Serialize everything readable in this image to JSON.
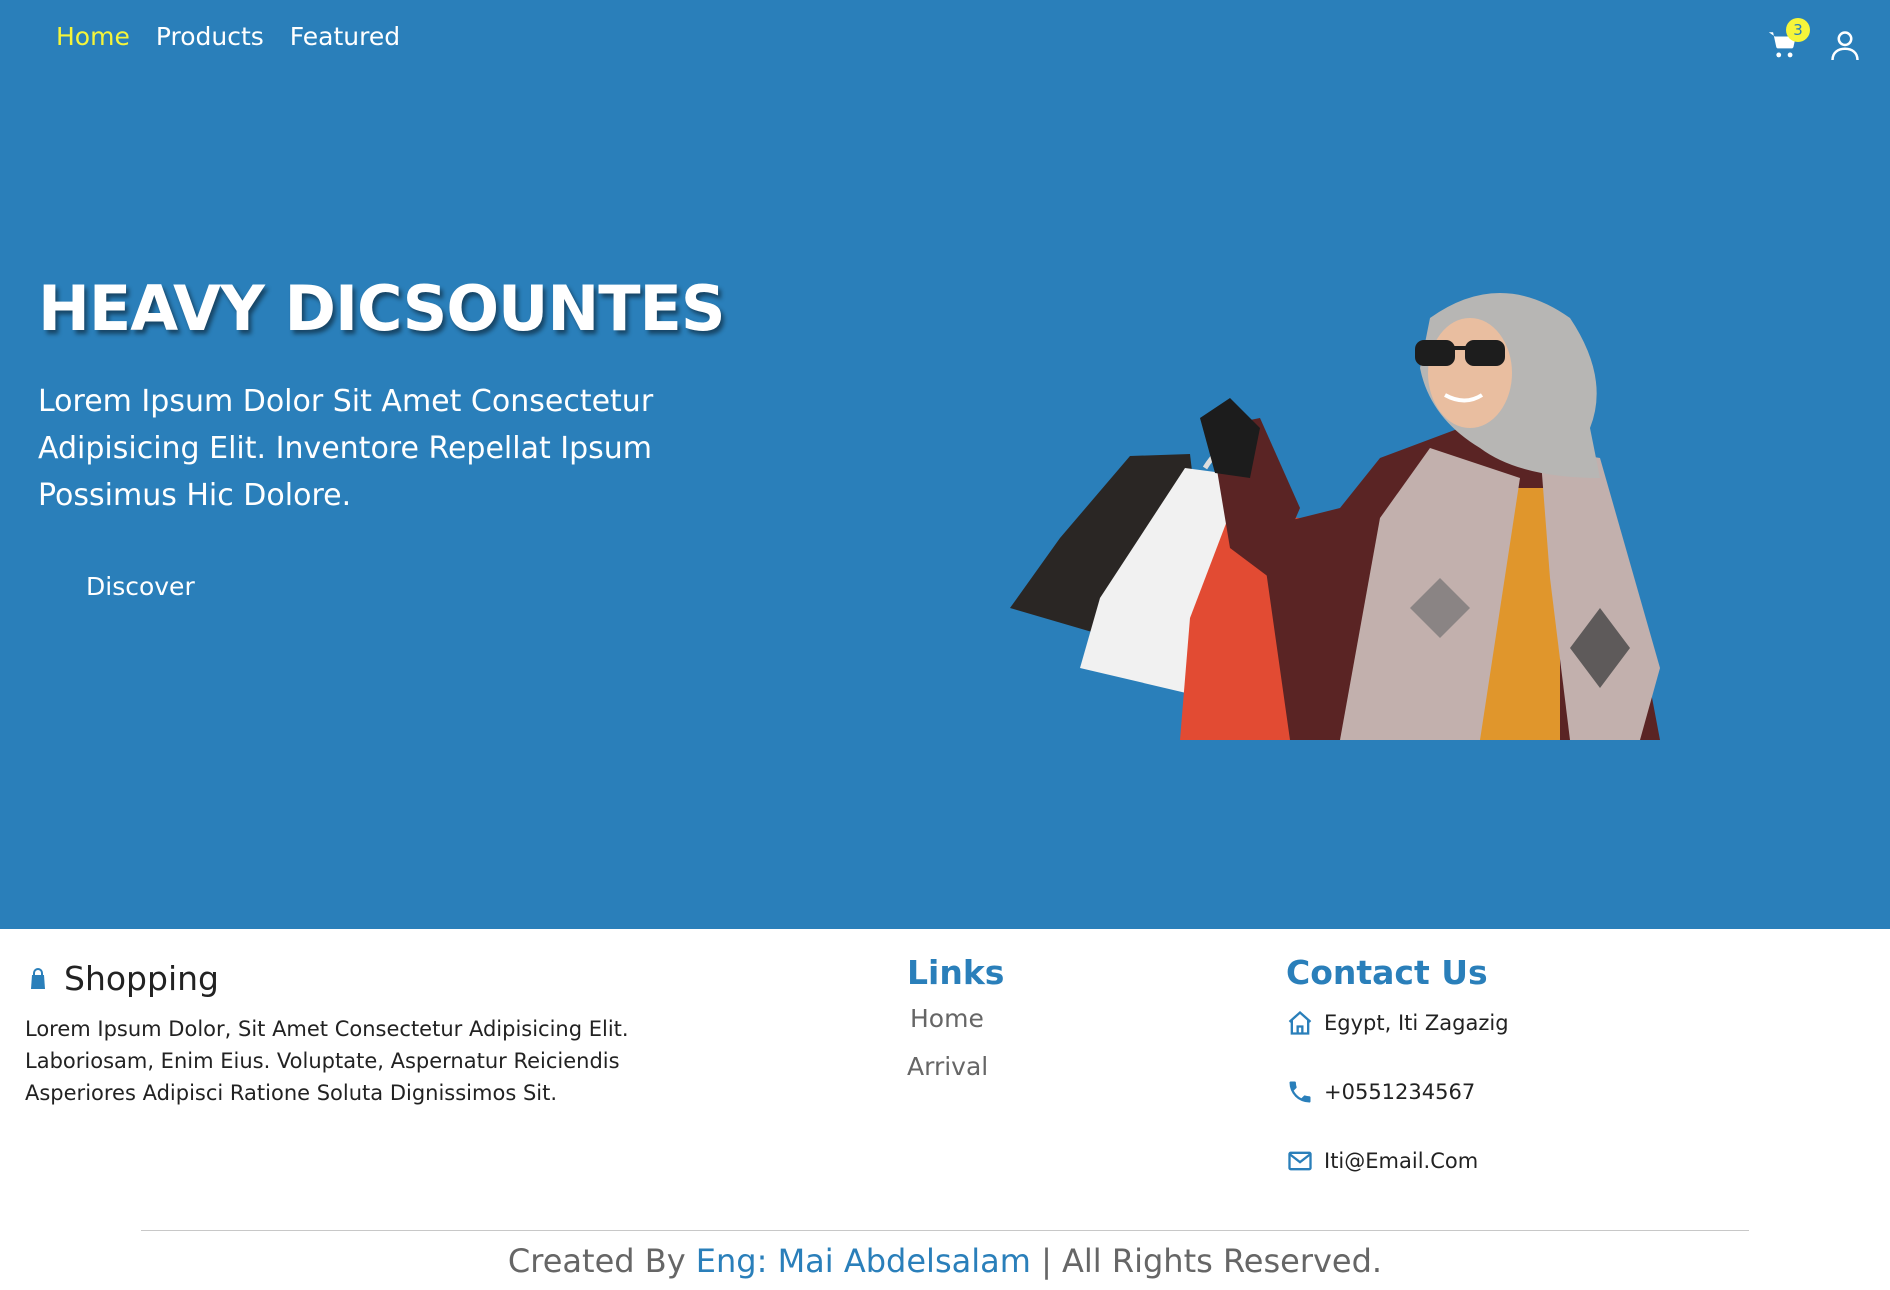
{
  "nav": {
    "items": [
      {
        "label": "Home",
        "active": true
      },
      {
        "label": "Products",
        "active": false
      },
      {
        "label": "Featured",
        "active": false
      }
    ]
  },
  "header_icons": {
    "cart_icon": "shopping-cart",
    "cart_count": "3",
    "user_icon": "user"
  },
  "hero": {
    "title": "HEAVY DICSOUNTES",
    "text": "Lorem Ipsum Dolor Sit Amet Consectetur Adipisicing Elit. Inventore Repellat Ipsum Possimus Hic Dolore.",
    "button_label": "Discover"
  },
  "footer": {
    "brand_icon": "shopping-bag",
    "brand_title": "Shopping",
    "about": "Lorem Ipsum Dolor, Sit Amet Consectetur Adipisicing Elit. Laboriosam, Enim Eius. Voluptate, Aspernatur Reiciendis Asperiores Adipisci Ratione Soluta Dignissimos Sit.",
    "links_title": "Links",
    "links": [
      "Home",
      "Arrival"
    ],
    "contact_title": "Contact Us",
    "contact": [
      {
        "icon": "home-icon",
        "text": "Egypt, Iti Zagazig"
      },
      {
        "icon": "phone-icon",
        "text": "+0551234567"
      },
      {
        "icon": "mail-icon",
        "text": "Iti@Email.Com"
      }
    ],
    "copyright_prefix": "Created By",
    "copyright_author": "Eng: Mai Abdelsalam",
    "copyright_suffix": "| All Rights Reserved."
  },
  "colors": {
    "primary": "#2a7fba",
    "accent": "#f5f53a"
  }
}
